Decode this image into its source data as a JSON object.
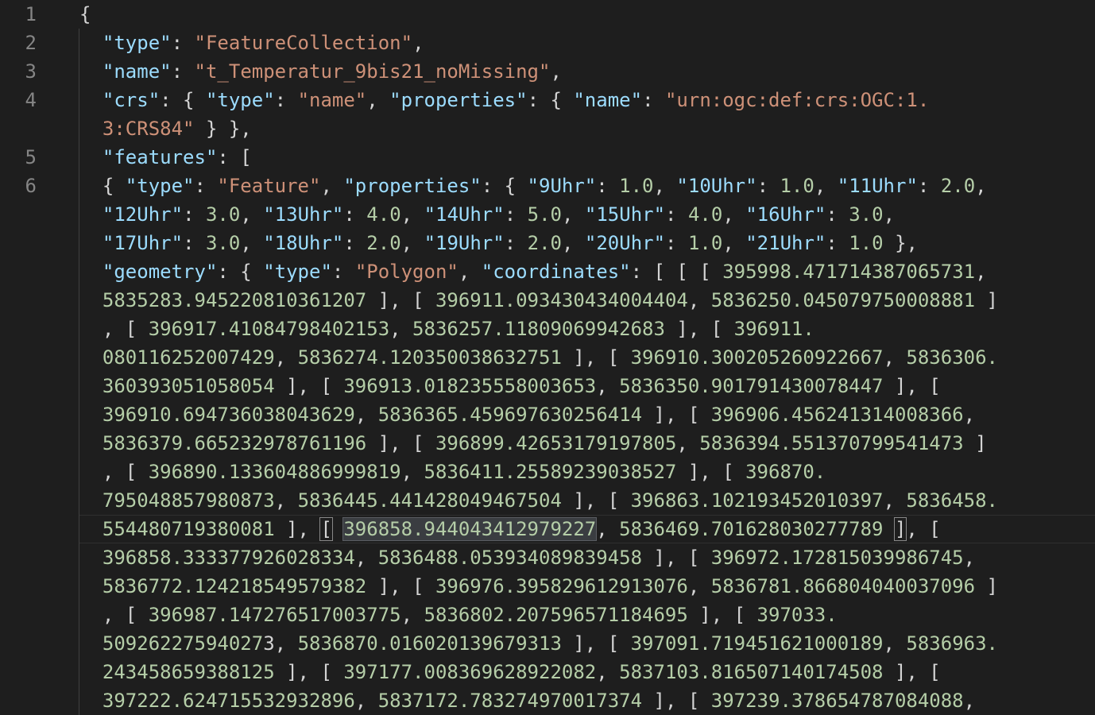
{
  "editor": {
    "line_numbers": [
      "1",
      "2",
      "3",
      "4",
      "5",
      "6"
    ],
    "rows": [
      [
        {
          "c": "p",
          "t": "{"
        }
      ],
      [
        {
          "c": "p",
          "t": "  "
        },
        {
          "c": "k",
          "t": "\"type\""
        },
        {
          "c": "p",
          "t": ": "
        },
        {
          "c": "s",
          "t": "\"FeatureCollection\""
        },
        {
          "c": "p",
          "t": ","
        }
      ],
      [
        {
          "c": "p",
          "t": "  "
        },
        {
          "c": "k",
          "t": "\"name\""
        },
        {
          "c": "p",
          "t": ": "
        },
        {
          "c": "s",
          "t": "\"t_Temperatur_9bis21_noMissing\""
        },
        {
          "c": "p",
          "t": ","
        }
      ],
      [
        {
          "c": "p",
          "t": "  "
        },
        {
          "c": "k",
          "t": "\"crs\""
        },
        {
          "c": "p",
          "t": ": { "
        },
        {
          "c": "k",
          "t": "\"type\""
        },
        {
          "c": "p",
          "t": ": "
        },
        {
          "c": "s",
          "t": "\"name\""
        },
        {
          "c": "p",
          "t": ", "
        },
        {
          "c": "k",
          "t": "\"properties\""
        },
        {
          "c": "p",
          "t": ": { "
        },
        {
          "c": "k",
          "t": "\"name\""
        },
        {
          "c": "p",
          "t": ": "
        },
        {
          "c": "s",
          "t": "\"urn:ogc:def:crs:OGC:1."
        }
      ],
      [
        {
          "c": "p",
          "t": "  "
        },
        {
          "c": "s",
          "t": "3:CRS84\""
        },
        {
          "c": "p",
          "t": " } },"
        }
      ],
      [
        {
          "c": "p",
          "t": "  "
        },
        {
          "c": "k",
          "t": "\"features\""
        },
        {
          "c": "p",
          "t": ": ["
        }
      ],
      [
        {
          "c": "p",
          "t": "  { "
        },
        {
          "c": "k",
          "t": "\"type\""
        },
        {
          "c": "p",
          "t": ": "
        },
        {
          "c": "s",
          "t": "\"Feature\""
        },
        {
          "c": "p",
          "t": ", "
        },
        {
          "c": "k",
          "t": "\"properties\""
        },
        {
          "c": "p",
          "t": ": { "
        },
        {
          "c": "k",
          "t": "\"9Uhr\""
        },
        {
          "c": "p",
          "t": ": "
        },
        {
          "c": "n",
          "t": "1.0"
        },
        {
          "c": "p",
          "t": ", "
        },
        {
          "c": "k",
          "t": "\"10Uhr\""
        },
        {
          "c": "p",
          "t": ": "
        },
        {
          "c": "n",
          "t": "1.0"
        },
        {
          "c": "p",
          "t": ", "
        },
        {
          "c": "k",
          "t": "\"11Uhr\""
        },
        {
          "c": "p",
          "t": ": "
        },
        {
          "c": "n",
          "t": "2.0"
        },
        {
          "c": "p",
          "t": ","
        }
      ],
      [
        {
          "c": "p",
          "t": "  "
        },
        {
          "c": "k",
          "t": "\"12Uhr\""
        },
        {
          "c": "p",
          "t": ": "
        },
        {
          "c": "n",
          "t": "3.0"
        },
        {
          "c": "p",
          "t": ", "
        },
        {
          "c": "k",
          "t": "\"13Uhr\""
        },
        {
          "c": "p",
          "t": ": "
        },
        {
          "c": "n",
          "t": "4.0"
        },
        {
          "c": "p",
          "t": ", "
        },
        {
          "c": "k",
          "t": "\"14Uhr\""
        },
        {
          "c": "p",
          "t": ": "
        },
        {
          "c": "n",
          "t": "5.0"
        },
        {
          "c": "p",
          "t": ", "
        },
        {
          "c": "k",
          "t": "\"15Uhr\""
        },
        {
          "c": "p",
          "t": ": "
        },
        {
          "c": "n",
          "t": "4.0"
        },
        {
          "c": "p",
          "t": ", "
        },
        {
          "c": "k",
          "t": "\"16Uhr\""
        },
        {
          "c": "p",
          "t": ": "
        },
        {
          "c": "n",
          "t": "3.0"
        },
        {
          "c": "p",
          "t": ","
        }
      ],
      [
        {
          "c": "p",
          "t": "  "
        },
        {
          "c": "k",
          "t": "\"17Uhr\""
        },
        {
          "c": "p",
          "t": ": "
        },
        {
          "c": "n",
          "t": "3.0"
        },
        {
          "c": "p",
          "t": ", "
        },
        {
          "c": "k",
          "t": "\"18Uhr\""
        },
        {
          "c": "p",
          "t": ": "
        },
        {
          "c": "n",
          "t": "2.0"
        },
        {
          "c": "p",
          "t": ", "
        },
        {
          "c": "k",
          "t": "\"19Uhr\""
        },
        {
          "c": "p",
          "t": ": "
        },
        {
          "c": "n",
          "t": "2.0"
        },
        {
          "c": "p",
          "t": ", "
        },
        {
          "c": "k",
          "t": "\"20Uhr\""
        },
        {
          "c": "p",
          "t": ": "
        },
        {
          "c": "n",
          "t": "1.0"
        },
        {
          "c": "p",
          "t": ", "
        },
        {
          "c": "k",
          "t": "\"21Uhr\""
        },
        {
          "c": "p",
          "t": ": "
        },
        {
          "c": "n",
          "t": "1.0"
        },
        {
          "c": "p",
          "t": " },"
        }
      ],
      [
        {
          "c": "p",
          "t": "  "
        },
        {
          "c": "k",
          "t": "\"geometry\""
        },
        {
          "c": "p",
          "t": ": { "
        },
        {
          "c": "k",
          "t": "\"type\""
        },
        {
          "c": "p",
          "t": ": "
        },
        {
          "c": "s",
          "t": "\"Polygon\""
        },
        {
          "c": "p",
          "t": ", "
        },
        {
          "c": "k",
          "t": "\"coordinates\""
        },
        {
          "c": "p",
          "t": ": [ [ [ "
        },
        {
          "c": "n",
          "t": "395998.471714387065731"
        },
        {
          "c": "p",
          "t": ","
        }
      ],
      [
        {
          "c": "p",
          "t": "  "
        },
        {
          "c": "n",
          "t": "5835283.945220810361207"
        },
        {
          "c": "p",
          "t": " ], [ "
        },
        {
          "c": "n",
          "t": "396911.093430434004404"
        },
        {
          "c": "p",
          "t": ", "
        },
        {
          "c": "n",
          "t": "5836250.045079750008881"
        },
        {
          "c": "p",
          "t": " ]"
        }
      ],
      [
        {
          "c": "p",
          "t": "  , [ "
        },
        {
          "c": "n",
          "t": "396917.41084798402153"
        },
        {
          "c": "p",
          "t": ", "
        },
        {
          "c": "n",
          "t": "5836257.11809069942683"
        },
        {
          "c": "p",
          "t": " ], [ "
        },
        {
          "c": "n",
          "t": "396911."
        }
      ],
      [
        {
          "c": "p",
          "t": "  "
        },
        {
          "c": "n",
          "t": "080116252007429"
        },
        {
          "c": "p",
          "t": ", "
        },
        {
          "c": "n",
          "t": "5836274.120350038632751"
        },
        {
          "c": "p",
          "t": " ], [ "
        },
        {
          "c": "n",
          "t": "396910.300205260922667"
        },
        {
          "c": "p",
          "t": ", "
        },
        {
          "c": "n",
          "t": "5836306."
        }
      ],
      [
        {
          "c": "p",
          "t": "  "
        },
        {
          "c": "n",
          "t": "360393051058054"
        },
        {
          "c": "p",
          "t": " ], [ "
        },
        {
          "c": "n",
          "t": "396913.018235558003653"
        },
        {
          "c": "p",
          "t": ", "
        },
        {
          "c": "n",
          "t": "5836350.901791430078447"
        },
        {
          "c": "p",
          "t": " ], ["
        }
      ],
      [
        {
          "c": "p",
          "t": "  "
        },
        {
          "c": "n",
          "t": "396910.694736038043629"
        },
        {
          "c": "p",
          "t": ", "
        },
        {
          "c": "n",
          "t": "5836365.459697630256414"
        },
        {
          "c": "p",
          "t": " ], [ "
        },
        {
          "c": "n",
          "t": "396906.456241314008366"
        },
        {
          "c": "p",
          "t": ","
        }
      ],
      [
        {
          "c": "p",
          "t": "  "
        },
        {
          "c": "n",
          "t": "5836379.665232978761196"
        },
        {
          "c": "p",
          "t": " ], [ "
        },
        {
          "c": "n",
          "t": "396899.42653179197805"
        },
        {
          "c": "p",
          "t": ", "
        },
        {
          "c": "n",
          "t": "5836394.551370799541473"
        },
        {
          "c": "p",
          "t": " ]"
        }
      ],
      [
        {
          "c": "p",
          "t": "  , [ "
        },
        {
          "c": "n",
          "t": "396890.133604886999819"
        },
        {
          "c": "p",
          "t": ", "
        },
        {
          "c": "n",
          "t": "5836411.25589239038527"
        },
        {
          "c": "p",
          "t": " ], [ "
        },
        {
          "c": "n",
          "t": "396870."
        }
      ],
      [
        {
          "c": "p",
          "t": "  "
        },
        {
          "c": "n",
          "t": "795048857980873"
        },
        {
          "c": "p",
          "t": ", "
        },
        {
          "c": "n",
          "t": "5836445.441428049467504"
        },
        {
          "c": "p",
          "t": " ], [ "
        },
        {
          "c": "n",
          "t": "396863.102193452010397"
        },
        {
          "c": "p",
          "t": ", "
        },
        {
          "c": "n",
          "t": "5836458."
        }
      ],
      [
        {
          "c": "p",
          "t": "  "
        },
        {
          "c": "n",
          "t": "554480719380081"
        },
        {
          "c": "p",
          "t": " ], "
        },
        {
          "c": "p bm",
          "t": "["
        },
        {
          "c": "p",
          "t": " "
        },
        {
          "c": "n hl",
          "t": "396858.944043412979227"
        },
        {
          "c": "p",
          "t": ", "
        },
        {
          "c": "n",
          "t": "5836469.701628030277789"
        },
        {
          "c": "p",
          "t": " "
        },
        {
          "c": "p bm",
          "t": "]"
        },
        {
          "c": "p",
          "t": ", ["
        }
      ],
      [
        {
          "c": "p",
          "t": "  "
        },
        {
          "c": "n",
          "t": "396858.333377926028334"
        },
        {
          "c": "p",
          "t": ", "
        },
        {
          "c": "n",
          "t": "5836488.053934089839458"
        },
        {
          "c": "p",
          "t": " ], [ "
        },
        {
          "c": "n",
          "t": "396972.172815039986745"
        },
        {
          "c": "p",
          "t": ","
        }
      ],
      [
        {
          "c": "p",
          "t": "  "
        },
        {
          "c": "n",
          "t": "5836772.124218549579382"
        },
        {
          "c": "p",
          "t": " ], [ "
        },
        {
          "c": "n",
          "t": "396976.395829612913076"
        },
        {
          "c": "p",
          "t": ", "
        },
        {
          "c": "n",
          "t": "5836781.866804040037096"
        },
        {
          "c": "p",
          "t": " ]"
        }
      ],
      [
        {
          "c": "p",
          "t": "  , [ "
        },
        {
          "c": "n",
          "t": "396987.147276517003775"
        },
        {
          "c": "p",
          "t": ", "
        },
        {
          "c": "n",
          "t": "5836802.207596571184695"
        },
        {
          "c": "p",
          "t": " ], [ "
        },
        {
          "c": "n",
          "t": "397033."
        }
      ],
      [
        {
          "c": "p",
          "t": "  "
        },
        {
          "c": "n",
          "t": "50926227594027"
        },
        {
          "c": "p",
          "t": "3, "
        },
        {
          "c": "n",
          "t": "5836870.016020139679313"
        },
        {
          "c": "p",
          "t": " ], [ "
        },
        {
          "c": "n",
          "t": "397091.719451621000189"
        },
        {
          "c": "p",
          "t": ", "
        },
        {
          "c": "n",
          "t": "5836963."
        }
      ],
      [
        {
          "c": "p",
          "t": "  "
        },
        {
          "c": "n",
          "t": "243458659388125"
        },
        {
          "c": "p",
          "t": " ], [ "
        },
        {
          "c": "n",
          "t": "397177.008369628922082"
        },
        {
          "c": "p",
          "t": ", "
        },
        {
          "c": "n",
          "t": "5837103.816507140174508"
        },
        {
          "c": "p",
          "t": " ], ["
        }
      ],
      [
        {
          "c": "p",
          "t": "  "
        },
        {
          "c": "n",
          "t": "397222.624715532932896"
        },
        {
          "c": "p",
          "t": ", "
        },
        {
          "c": "n",
          "t": "5837172.783274970017374"
        },
        {
          "c": "p",
          "t": " ], [ "
        },
        {
          "c": "n",
          "t": "397239.378654787084088"
        },
        {
          "c": "p",
          "t": ","
        }
      ]
    ],
    "row_line_numbers": [
      "1",
      "2",
      "3",
      "4",
      "",
      "5",
      "6",
      "",
      "",
      "",
      "",
      "",
      "",
      "",
      "",
      "",
      "",
      "",
      "",
      "",
      "",
      "",
      "",
      "",
      ""
    ]
  },
  "colors": {
    "background": "#1e1e1e",
    "key": "#9cdcfe",
    "string": "#ce9178",
    "number": "#b5cea8",
    "punctuation": "#d4d4d4",
    "line_number": "#858585"
  }
}
